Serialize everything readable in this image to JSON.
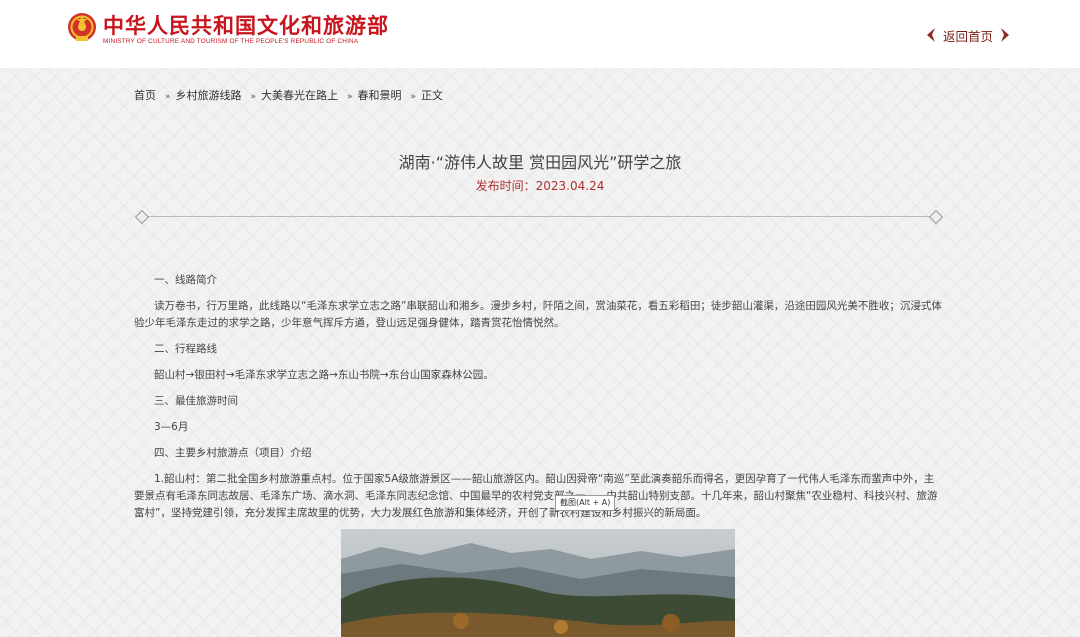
{
  "header": {
    "title": "中华人民共和国文化和旅游部",
    "subtitle": "MINISTRY OF CULTURE AND TOURISM OF THE PEOPLE'S REPUBLIC OF CHINA",
    "home_link": "返回首页"
  },
  "breadcrumb": [
    "首页",
    "乡村旅游线路",
    "大美春光在路上",
    "春和景明",
    "正文"
  ],
  "article": {
    "title": "湖南·“游伟人故里 赏田园风光”研学之旅",
    "published": "发布时间：2023.04.24",
    "paragraphs": [
      "一、线路简介",
      "读万卷书，行万里路，此线路以“毛泽东求学立志之路”串联韶山和湘乡。漫步乡村，阡陌之间，赏油菜花，看五彩稻田；徒步韶山灌渠，沿途田园风光美不胜收；沉浸式体验少年毛泽东走过的求学之路，少年意气挥斥方遒，登山远足强身健体，踏青赏花怡情悦然。",
      "二、行程路线",
      "韶山村→银田村→毛泽东求学立志之路→东山书院→东台山国家森林公园。",
      "三、最佳旅游时间",
      "3—6月",
      "四、主要乡村旅游点（项目）介绍",
      "1.韶山村：第二批全国乡村旅游重点村。位于国家5A级旅游景区——韶山旅游区内。韶山因舜帝“南巡”至此演奏韶乐而得名，更因孕育了一代伟人毛泽东而蜚声中外，主要景点有毛泽东同志故居、毛泽东广场、滴水洞、毛泽东同志纪念馆、中国最早的农村党支部之一——中共韶山特别支部。十几年来，韶山村聚焦“农业稳村、科技兴村、旅游富村”，坚持党建引领，充分发挥主席故里的优势，大力发展红色旅游和集体经济，开创了新农村建设和乡村振兴的新局面。"
    ]
  },
  "tooltip": "截图(Alt + A)",
  "colors": {
    "brand_red": "#c8151d",
    "date_red": "#b03030",
    "link_dark": "#7a1c16"
  }
}
